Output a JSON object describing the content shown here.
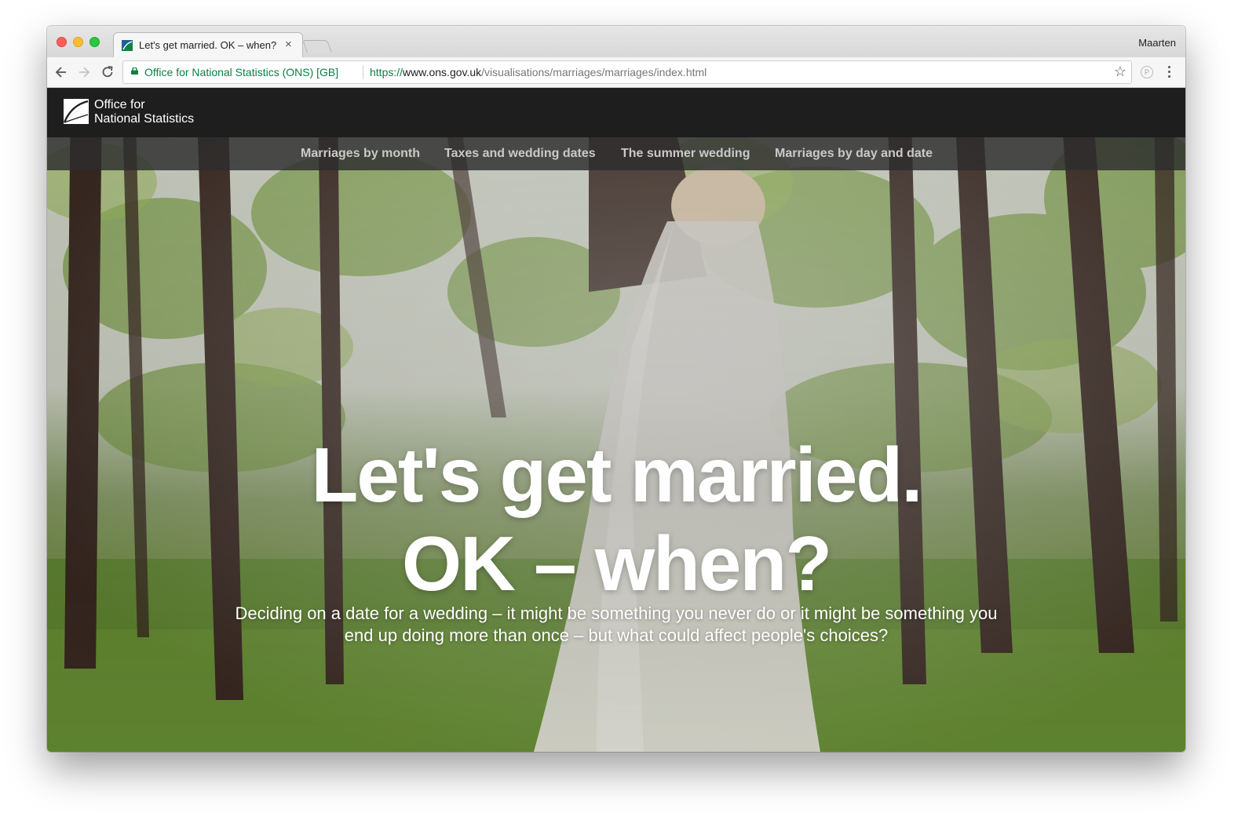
{
  "browser": {
    "tab_title": "Let's get married. OK – when?",
    "tab_close": "×",
    "profile_name": "Maarten",
    "secure_label": "Office for National Statistics (ONS) [GB]",
    "url_scheme": "https://",
    "url_host": "www.ons.gov.uk",
    "url_path": "/visualisations/marriages/marriages/index.html",
    "star_glyph": "☆",
    "extension_glyph": "P"
  },
  "site": {
    "logo_line1": "Office for",
    "logo_line2": "National Statistics",
    "nav": [
      {
        "label": "Marriages by month"
      },
      {
        "label": "Taxes and wedding dates"
      },
      {
        "label": "The summer wedding"
      },
      {
        "label": "Marriages by day and date"
      }
    ]
  },
  "hero": {
    "title_line1": "Let's get married.",
    "title_line2": "OK – when?",
    "subtitle": "Deciding on a date for a wedding – it might be something you never do or it might be something you end up doing more than once – but what could affect people's choices?"
  },
  "colors": {
    "header_bg": "#1e1e1e",
    "secure_green": "#0b8043",
    "nav_text": "#c9c9c9"
  }
}
